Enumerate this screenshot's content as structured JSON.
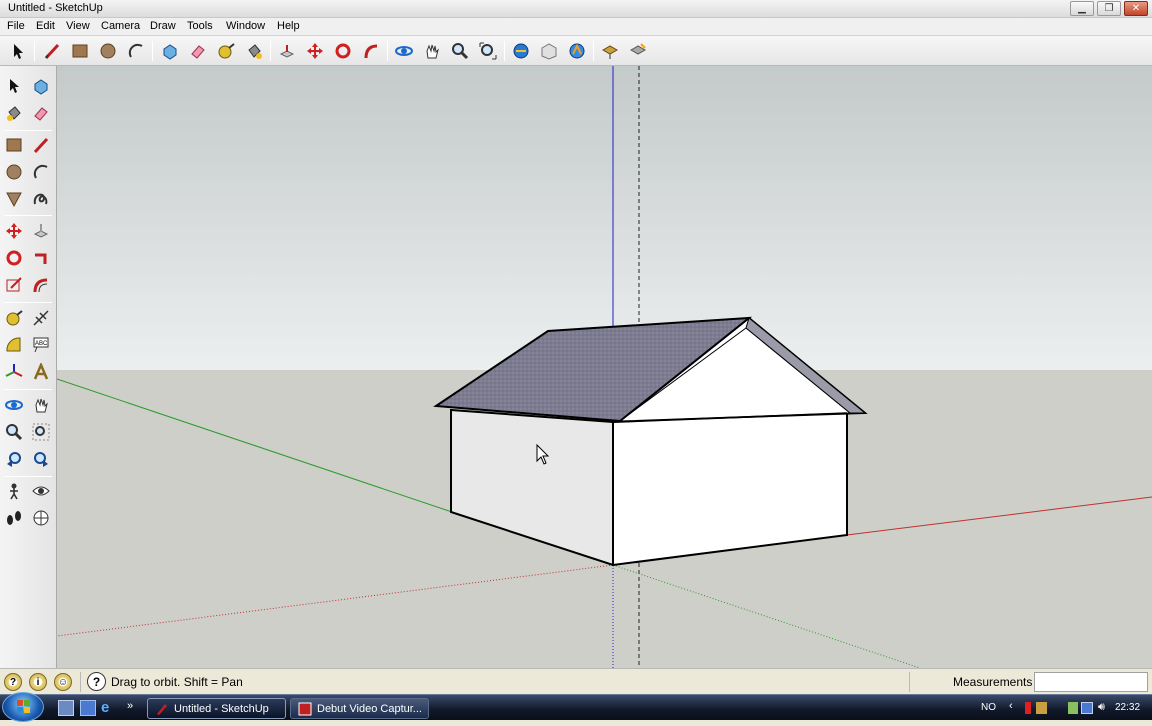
{
  "window": {
    "title": "Untitled - SketchUp"
  },
  "menu": [
    "File",
    "Edit",
    "View",
    "Camera",
    "Draw",
    "Tools",
    "Window",
    "Help"
  ],
  "toolbar_icons": [
    "select-icon",
    "line-icon",
    "rectangle-icon",
    "circle-icon",
    "arc-icon",
    "make-component-icon",
    "eraser-icon",
    "tape-measure-icon",
    "paint-bucket-icon",
    "push-pull-icon",
    "move-icon",
    "rotate-icon",
    "follow-me-icon",
    "orbit-icon",
    "pan-icon",
    "zoom-icon",
    "zoom-extents-icon",
    "get-models-icon",
    "share-model-icon",
    "google-earth-icon",
    "get-current-view-icon",
    "toggle-terrain-icon"
  ],
  "left_toolbar_icons": [
    "select-icon",
    "make-component-icon",
    "paint-bucket-icon",
    "eraser-icon",
    "rectangle-icon",
    "line-icon",
    "circle-icon",
    "arc-icon",
    "polygon-icon",
    "freehand-icon",
    "move-icon",
    "push-pull-icon",
    "rotate-icon",
    "follow-me-icon",
    "scale-icon",
    "offset-icon",
    "tape-measure-icon",
    "dimension-icon",
    "protractor-icon",
    "text-icon",
    "axes-icon",
    "3d-text-icon",
    "orbit-icon",
    "pan-icon",
    "zoom-icon",
    "zoom-window-icon",
    "previous-view-icon",
    "next-view-icon",
    "position-camera-icon",
    "look-around-icon",
    "walk-icon",
    "section-plane-icon"
  ],
  "colors": {
    "sky": "#d9dcdc",
    "ground": "#cfcfca",
    "roof": "#7c7b90",
    "wall": "#ffffff",
    "red_axis": "#c03030",
    "green_axis": "#2a9a2a",
    "blue_axis": "#2020c8"
  },
  "status": {
    "hint": "Drag to orbit.  Shift = Pan",
    "measurements_label": "Measurements",
    "measurements_value": ""
  },
  "taskbar": {
    "tasks": [
      {
        "label": "Untitled - SketchUp",
        "icon": "sketchup-icon",
        "active": true
      },
      {
        "label": "Debut Video Captur...",
        "icon": "debut-icon",
        "active": false
      }
    ],
    "tray": {
      "language": "NO",
      "clock": "22:32"
    }
  }
}
